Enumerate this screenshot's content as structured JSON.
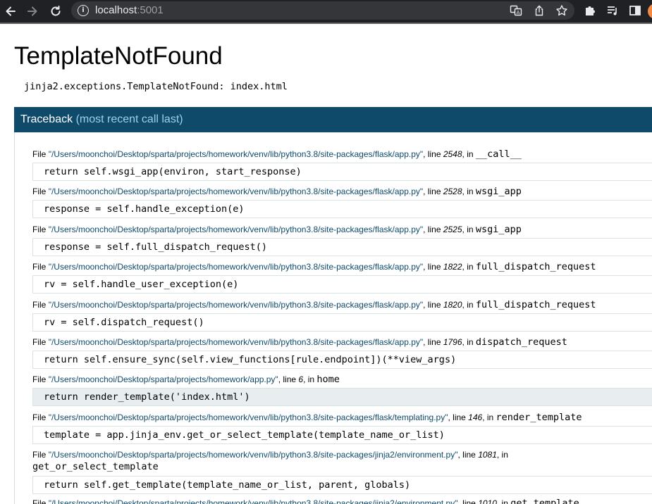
{
  "browser": {
    "url_host": "localhost",
    "url_port": ":5001",
    "icons": {
      "back": "arrow-left-icon",
      "forward": "arrow-right-icon",
      "reload": "reload-icon",
      "site_info": "info-icon",
      "translate": "translate-icon",
      "share": "share-icon",
      "bookmark": "star-icon",
      "extensions": "puzzle-icon",
      "media": "playlist-icon",
      "side_panel": "side-panel-icon",
      "profile": "avatar"
    },
    "colors": {
      "chrome_bg": "#202124",
      "omnibox_bg": "#35363a"
    }
  },
  "page": {
    "title": "TemplateNotFound",
    "exception": "jinja2.exceptions.TemplateNotFound: index.html",
    "traceback_title": "Traceback",
    "traceback_subtitle": "(most recent call last)",
    "colors": {
      "header_bg": "#0f4a6b",
      "link": "#0f4a6b"
    }
  },
  "frames": [
    {
      "prefix": "File",
      "filename": "\"/Users/moonchoi/Desktop/sparta/projects/homework/venv/lib/python3.8/site-packages/flask/app.py\"",
      "line_label": ", line ",
      "lineno": "2548",
      "in_label": ", in ",
      "function": "__call__",
      "code": "return self.wsgi_app(environ, start_response)"
    },
    {
      "prefix": "File",
      "filename": "\"/Users/moonchoi/Desktop/sparta/projects/homework/venv/lib/python3.8/site-packages/flask/app.py\"",
      "line_label": ", line ",
      "lineno": "2528",
      "in_label": ", in ",
      "function": "wsgi_app",
      "code": "response = self.handle_exception(e)"
    },
    {
      "prefix": "File",
      "filename": "\"/Users/moonchoi/Desktop/sparta/projects/homework/venv/lib/python3.8/site-packages/flask/app.py\"",
      "line_label": ", line ",
      "lineno": "2525",
      "in_label": ", in ",
      "function": "wsgi_app",
      "code": "response = self.full_dispatch_request()"
    },
    {
      "prefix": "File",
      "filename": "\"/Users/moonchoi/Desktop/sparta/projects/homework/venv/lib/python3.8/site-packages/flask/app.py\"",
      "line_label": ", line ",
      "lineno": "1822",
      "in_label": ", in ",
      "function": "full_dispatch_request",
      "code": "rv = self.handle_user_exception(e)"
    },
    {
      "prefix": "File",
      "filename": "\"/Users/moonchoi/Desktop/sparta/projects/homework/venv/lib/python3.8/site-packages/flask/app.py\"",
      "line_label": ", line ",
      "lineno": "1820",
      "in_label": ", in ",
      "function": "full_dispatch_request",
      "code": "rv = self.dispatch_request()"
    },
    {
      "prefix": "File",
      "filename": "\"/Users/moonchoi/Desktop/sparta/projects/homework/venv/lib/python3.8/site-packages/flask/app.py\"",
      "line_label": ", line ",
      "lineno": "1796",
      "in_label": ", in ",
      "function": "dispatch_request",
      "code": "return self.ensure_sync(self.view_functions[rule.endpoint])(**view_args)"
    },
    {
      "prefix": "File",
      "filename": "\"/Users/moonchoi/Desktop/sparta/projects/homework/app.py\"",
      "line_label": ", line ",
      "lineno": "6",
      "in_label": ", in ",
      "function": "home",
      "code": "return render_template('index.html')"
    },
    {
      "prefix": "File",
      "filename": "\"/Users/moonchoi/Desktop/sparta/projects/homework/venv/lib/python3.8/site-packages/flask/templating.py\"",
      "line_label": ", line ",
      "lineno": "146",
      "in_label": ", in ",
      "function": "render_template",
      "code": "template = app.jinja_env.get_or_select_template(template_name_or_list)"
    },
    {
      "prefix": "File",
      "filename": "\"/Users/moonchoi/Desktop/sparta/projects/homework/venv/lib/python3.8/site-packages/jinja2/environment.py\"",
      "line_label": ", line ",
      "lineno": "1081",
      "in_label": ", in ",
      "function": "get_or_select_template",
      "code": "return self.get_template(template_name_or_list, parent, globals)"
    },
    {
      "prefix": "File",
      "filename": "\"/Users/moonchoi/Desktop/sparta/projects/homework/venv/lib/python3.8/site-packages/jinja2/environment.py\"",
      "line_label": ", line ",
      "lineno": "1010",
      "in_label": ", in ",
      "function": "get_template"
    }
  ]
}
